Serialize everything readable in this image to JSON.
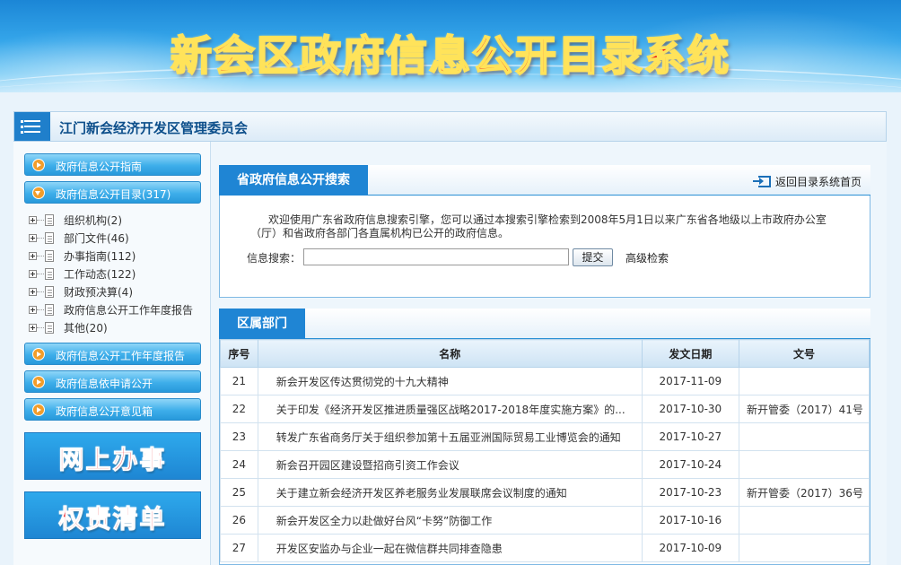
{
  "banner": {
    "title": "新会区政府信息公开目录系统"
  },
  "org": {
    "title": "江门新会经济开发区管理委员会"
  },
  "sidebar": {
    "nav_top": [
      {
        "label": "政府信息公开指南",
        "expanded": false
      },
      {
        "label": "政府信息公开目录(317)",
        "expanded": true
      }
    ],
    "tree": [
      {
        "label": "组织机构(2)"
      },
      {
        "label": "部门文件(46)"
      },
      {
        "label": "办事指南(112)"
      },
      {
        "label": "工作动态(122)"
      },
      {
        "label": "财政预决算(4)"
      },
      {
        "label": "政府信息公开工作年度报告"
      },
      {
        "label": "其他(20)"
      }
    ],
    "nav_bottom": [
      {
        "label": "政府信息公开工作年度报告"
      },
      {
        "label": "政府信息依申请公开"
      },
      {
        "label": "政府信息公开意见箱"
      }
    ],
    "promos": [
      {
        "label": "网上办事"
      },
      {
        "label": "权责清单"
      }
    ]
  },
  "search": {
    "tab": "省政府信息公开搜索",
    "back_link": "返回目录系统首页",
    "intro_line1": "欢迎使用广东省政府信息搜索引擎，您可以通过本搜索引擎检索到2008年5月1日以来广东省各地级以上市政府办公室",
    "intro_line2": "（厅）和省政府各部门各直属机构已公开的政府信息。",
    "label": "信息搜索：",
    "input_value": "",
    "submit": "提交",
    "advanced": "高级检索"
  },
  "dept": {
    "tab": "区属部门",
    "headers": {
      "idx": "序号",
      "name": "名称",
      "date": "发文日期",
      "doc_no": "文号"
    },
    "rows": [
      {
        "idx": "21",
        "name": "新会开发区传达贯彻党的十九大精神",
        "date": "2017-11-09",
        "doc_no": ""
      },
      {
        "idx": "22",
        "name": "关于印发《经济开发区推进质量强区战略2017-2018年度实施方案》的...",
        "date": "2017-10-30",
        "doc_no": "新开管委（2017）41号"
      },
      {
        "idx": "23",
        "name": "转发广东省商务厅关于组织参加第十五届亚洲国际贸易工业博览会的通知",
        "date": "2017-10-27",
        "doc_no": ""
      },
      {
        "idx": "24",
        "name": "新会召开园区建设暨招商引资工作会议",
        "date": "2017-10-24",
        "doc_no": ""
      },
      {
        "idx": "25",
        "name": "关于建立新会经济开发区养老服务业发展联席会议制度的通知",
        "date": "2017-10-23",
        "doc_no": "新开管委（2017）36号"
      },
      {
        "idx": "26",
        "name": "新会开发区全力以赴做好台风“卡努”防御工作",
        "date": "2017-10-16",
        "doc_no": ""
      },
      {
        "idx": "27",
        "name": "开发区安监办与企业一起在微信群共同排查隐患",
        "date": "2017-10-09",
        "doc_no": ""
      }
    ]
  }
}
